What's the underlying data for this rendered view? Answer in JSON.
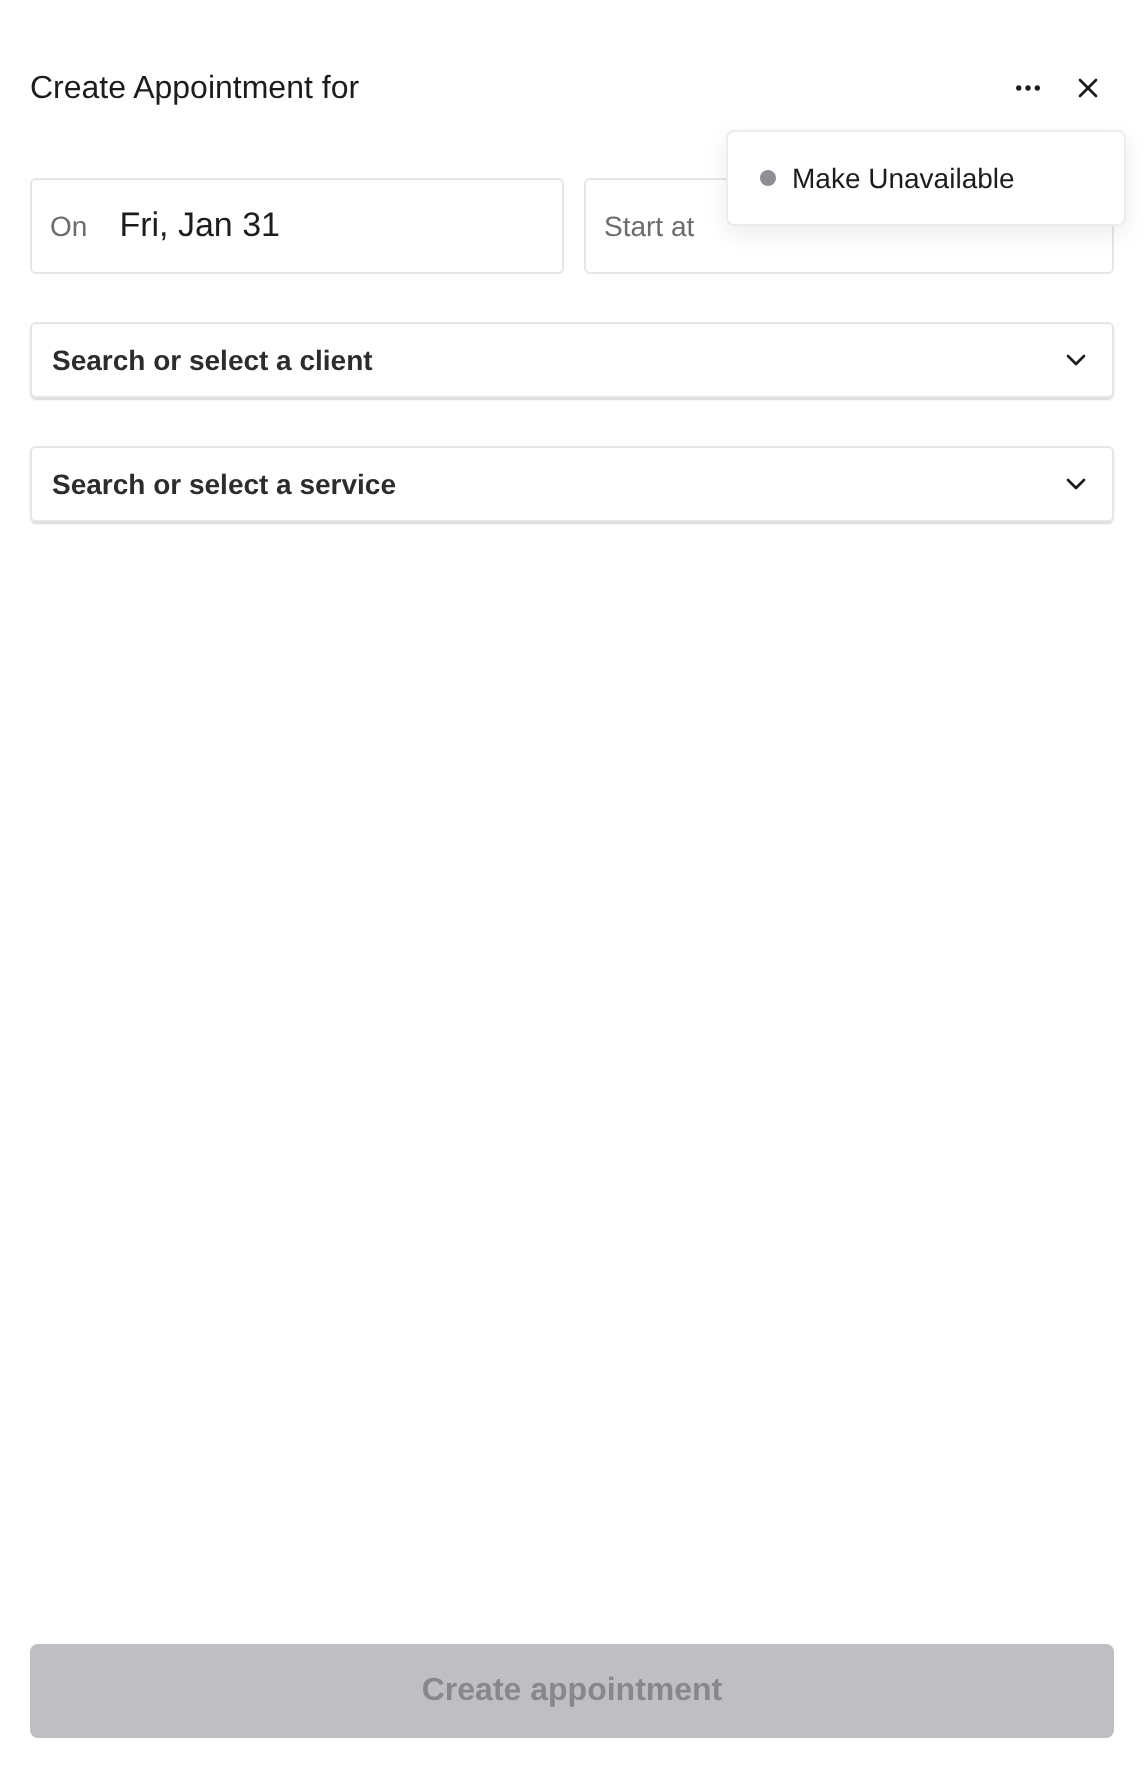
{
  "header": {
    "title": "Create Appointment for"
  },
  "menu": {
    "items": [
      {
        "label": "Make Unavailable",
        "color": "#8e8e93"
      }
    ]
  },
  "date_field": {
    "label": "On",
    "value": "Fri, Jan 31"
  },
  "time_field": {
    "label": "Start at"
  },
  "selects": [
    {
      "placeholder": "Search or select a client"
    },
    {
      "placeholder": "Search or select a service"
    }
  ],
  "submit": {
    "label": "Create appointment",
    "disabled": true
  }
}
